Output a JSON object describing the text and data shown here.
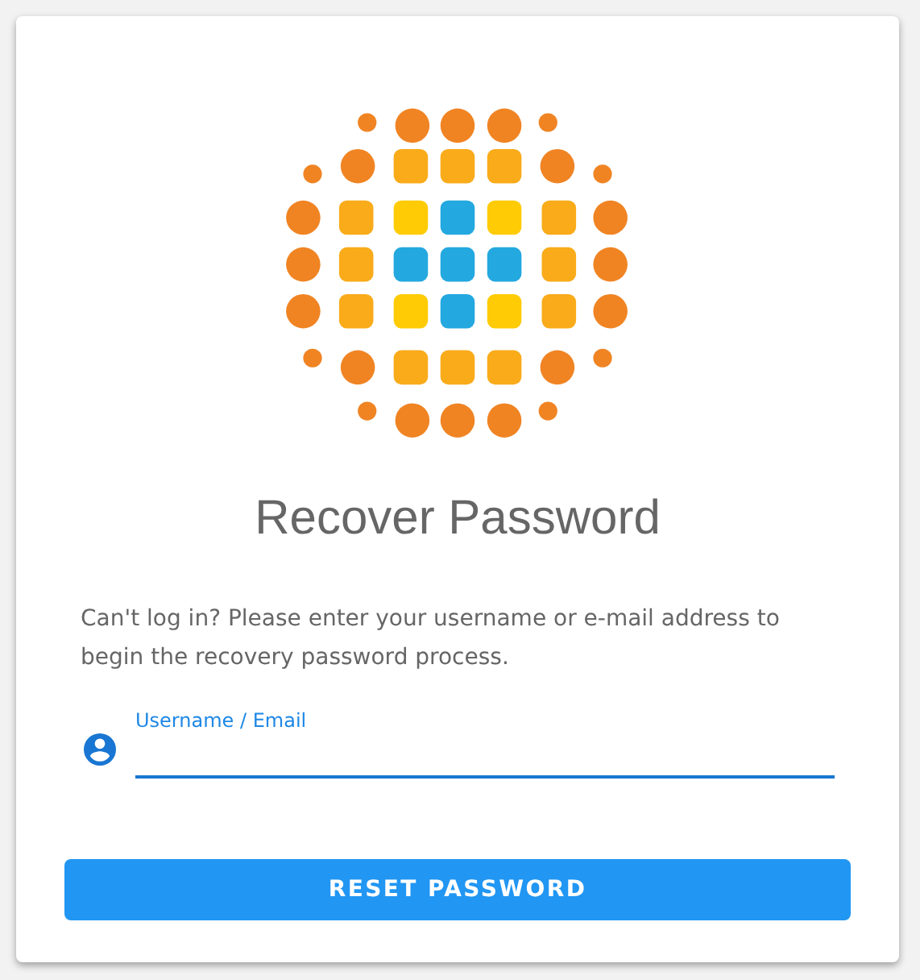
{
  "title": "Recover Password",
  "instructions": "Can't log in? Please enter your username or e-mail address to begin the recovery password process.",
  "field": {
    "label": "Username / Email",
    "focused": true
  },
  "button": {
    "label": "RESET PASSWORD"
  }
}
